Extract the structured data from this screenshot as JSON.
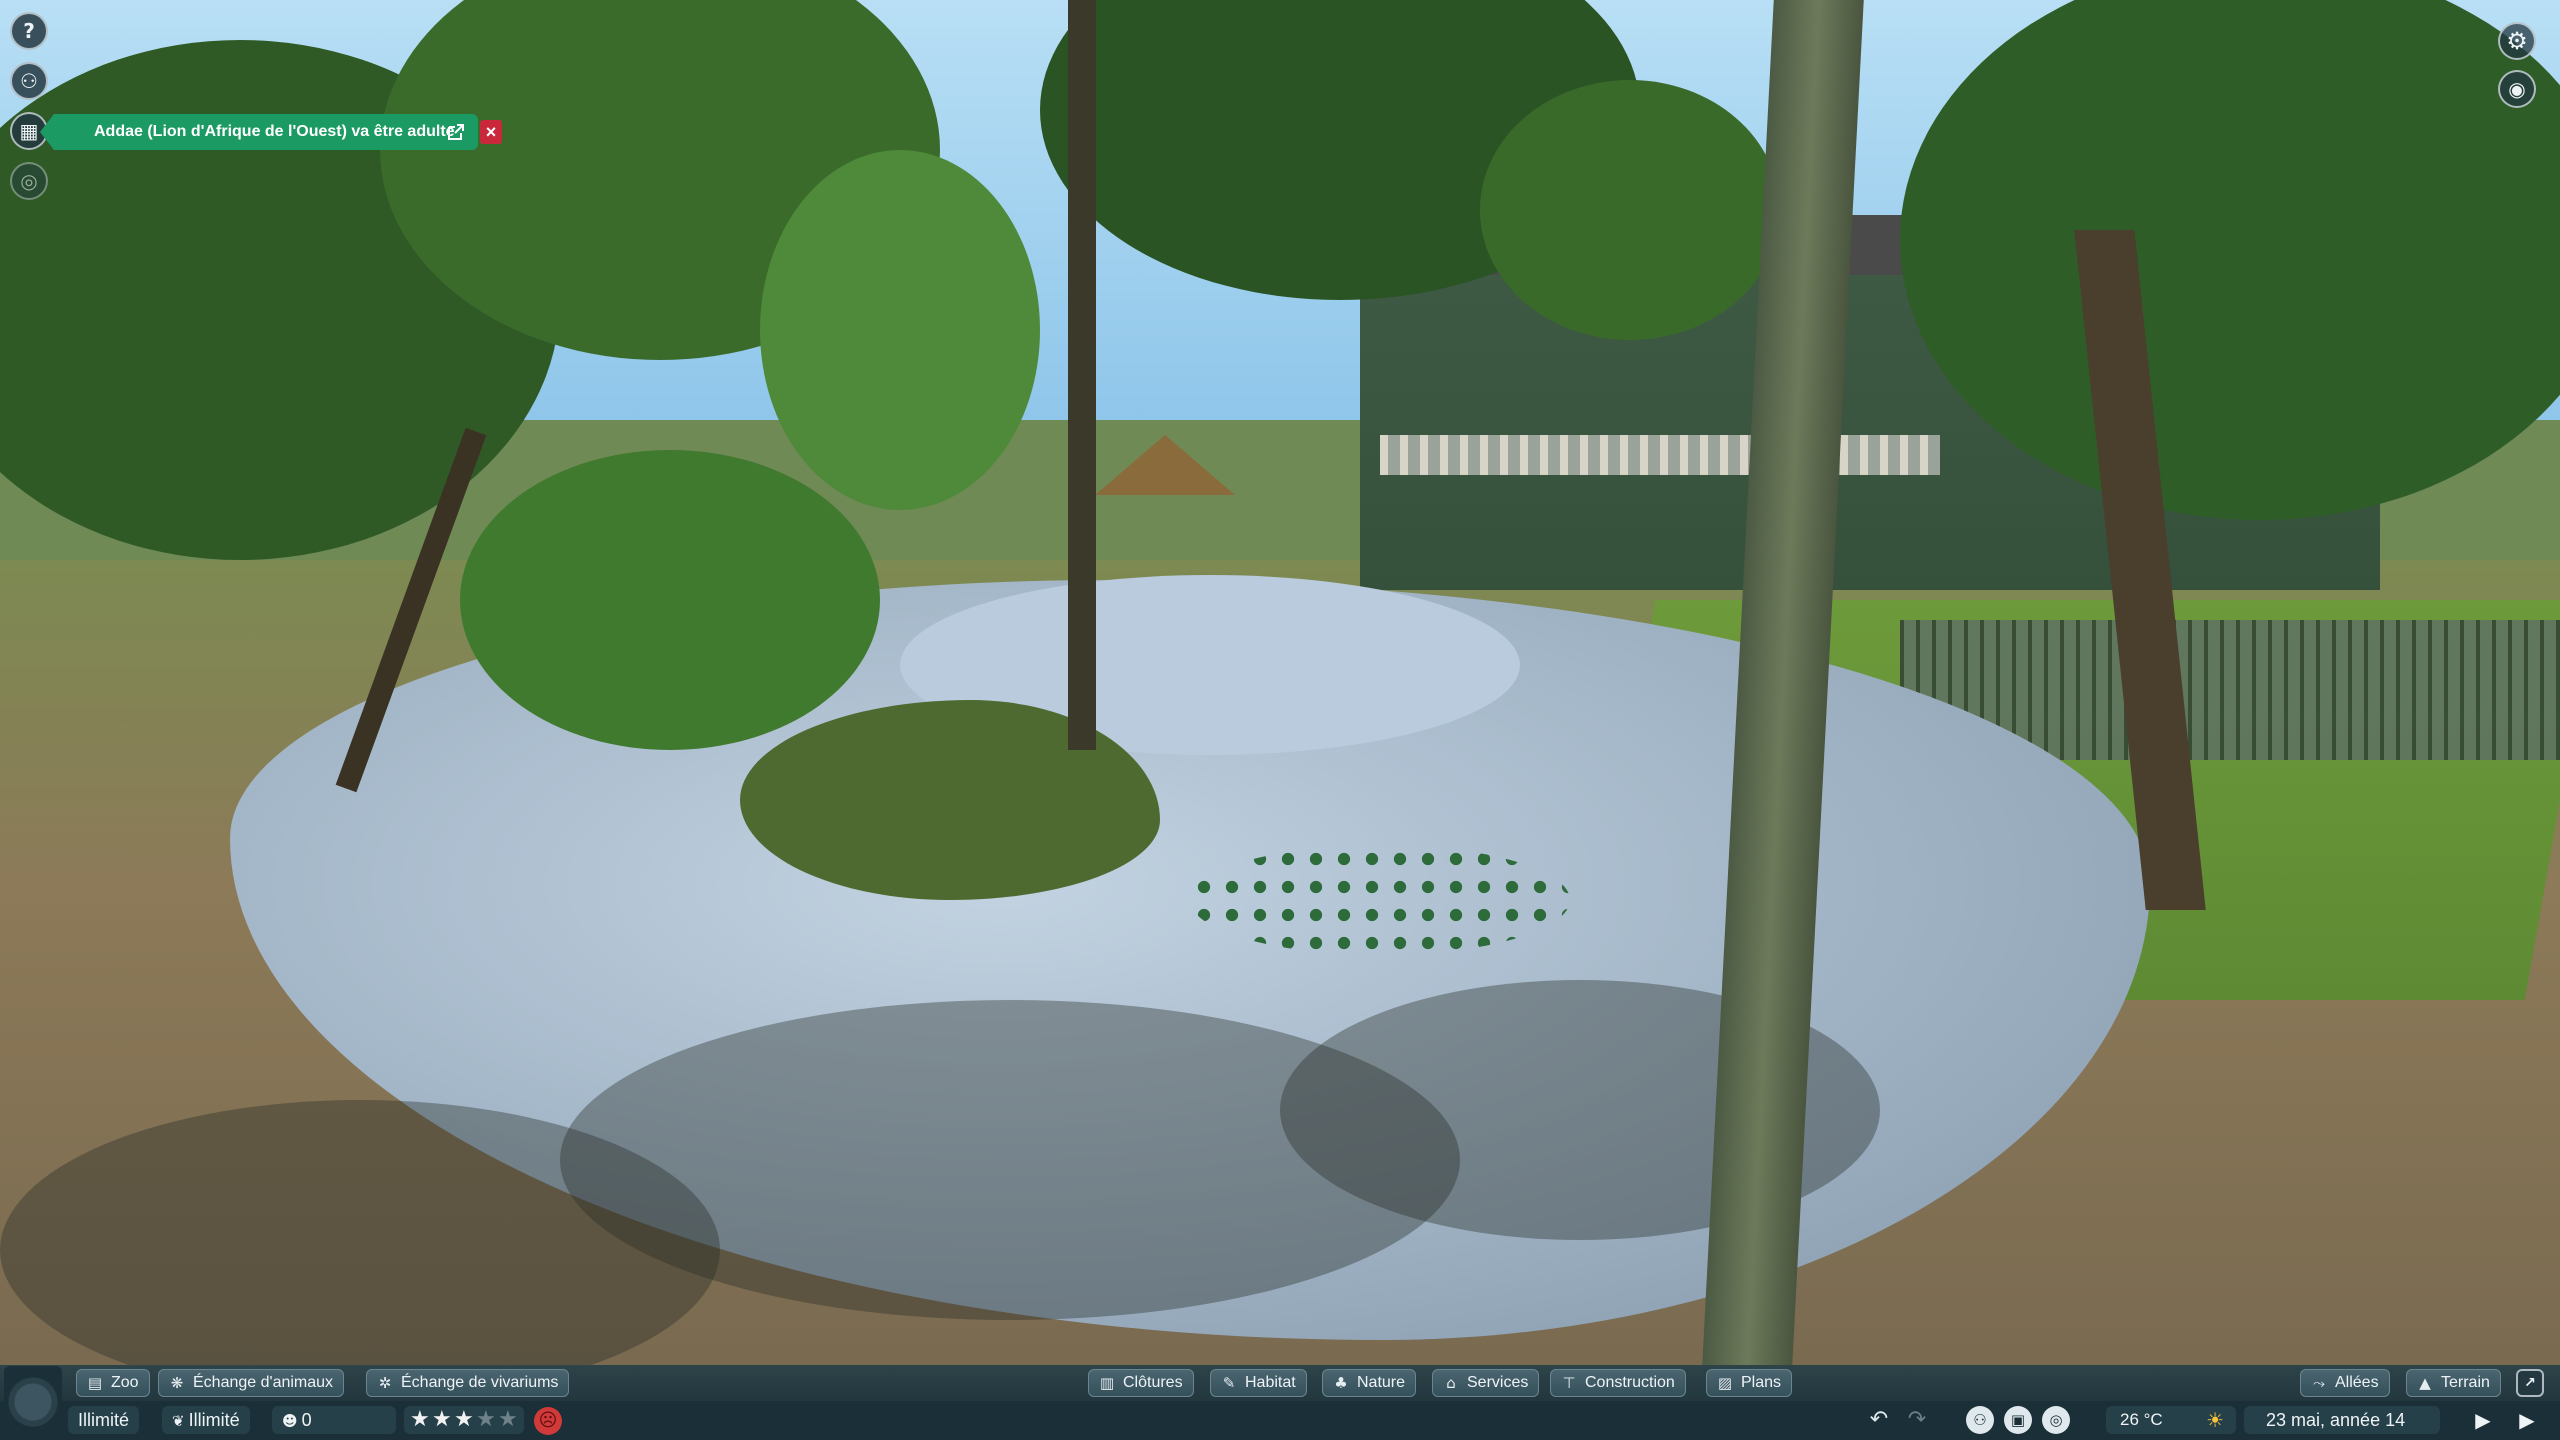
{
  "notification": {
    "text": "Addae (Lion d'Afrique de l'Ouest) va être adulte",
    "icon": "external-link-icon",
    "close_label": "×"
  },
  "left_tools": [
    {
      "name": "help-icon",
      "glyph": "?"
    },
    {
      "name": "animal-portrait-icon",
      "glyph": "⚇"
    },
    {
      "name": "calendar-icon",
      "glyph": "▦"
    },
    {
      "name": "target-icon",
      "glyph": "◎"
    }
  ],
  "right_tools": [
    {
      "name": "settings-gear-icon",
      "glyph": "⚙"
    },
    {
      "name": "camera-icon",
      "glyph": "◉"
    }
  ],
  "toolbar_left": [
    {
      "label": "Zoo",
      "icon": "zoo-icon",
      "glyph": "▤"
    },
    {
      "label": "Échange d'animaux",
      "icon": "paw-icon",
      "glyph": "❋"
    },
    {
      "label": "Échange de vivariums",
      "icon": "vivarium-icon",
      "glyph": "✲"
    }
  ],
  "toolbar_center": [
    {
      "label": "Clôtures",
      "icon": "fence-icon",
      "glyph": "▥"
    },
    {
      "label": "Habitat",
      "icon": "habitat-icon",
      "glyph": "✎"
    },
    {
      "label": "Nature",
      "icon": "tree-icon",
      "glyph": "♣"
    },
    {
      "label": "Services",
      "icon": "shop-icon",
      "glyph": "⌂"
    },
    {
      "label": "Construction",
      "icon": "construction-icon",
      "glyph": "⊤"
    },
    {
      "label": "Plans",
      "icon": "blueprint-icon",
      "glyph": "▨"
    }
  ],
  "toolbar_right": [
    {
      "label": "Allées",
      "icon": "path-icon",
      "glyph": "⤳"
    },
    {
      "label": "Terrain",
      "icon": "terrain-icon",
      "glyph": "▲"
    }
  ],
  "status": {
    "money": "Illimité",
    "research": "Illimité",
    "guests": "0",
    "rating_stars": 3,
    "rating_max": 5,
    "temperature": "26 °C",
    "date": "23 mai, année 14"
  },
  "colors": {
    "notification": "#1c9a63",
    "close": "#c9283b",
    "hud": "#1b2f38",
    "mood": "#d23a3a"
  }
}
